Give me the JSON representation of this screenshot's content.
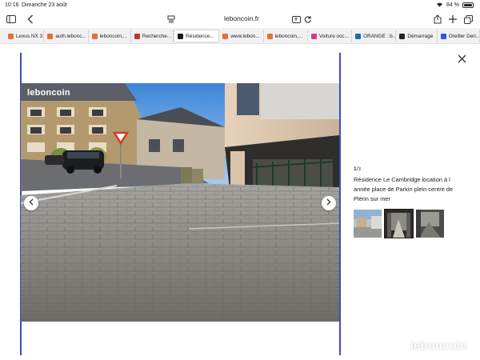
{
  "status_bar": {
    "time": "10:16",
    "date": "Dimanche 23 août",
    "battery": "84 %",
    "battery_level": 0.84
  },
  "toolbar": {
    "url": "leboncoin.fr"
  },
  "tabs": [
    {
      "label": "Lexus NX 3",
      "favicon_color": "#e5703b"
    },
    {
      "label": "auth.lebonc...",
      "favicon_color": "#e5703b"
    },
    {
      "label": "leboncoin,...",
      "favicon_color": "#e5703b"
    },
    {
      "label": "Recherche...",
      "favicon_color": "#c0392b"
    },
    {
      "label": "Résidence...",
      "favicon_color": "#1a1a1a",
      "active": true
    },
    {
      "label": "www.lebon...",
      "favicon_color": "#e5703b"
    },
    {
      "label": "leboncoin,...",
      "favicon_color": "#e5703b"
    },
    {
      "label": "Voiture occ...",
      "favicon_color": "#d63c8a"
    },
    {
      "label": "ORANGE : b...",
      "favicon_color": "#1c6ab5"
    },
    {
      "label": "Démarrage",
      "favicon_color": "#222222"
    },
    {
      "label": "Oreiller Deri...",
      "favicon_color": "#2a5bd7"
    }
  ],
  "listing": {
    "photo_logo": "leboncoin",
    "counter_current": "1",
    "counter_total": "/3",
    "title": "Résidence Le Cambridge location à l année place de Parkin plein centre de Plérin sur mer",
    "thumbnail_count": 3
  },
  "watermark": "leboncoin",
  "colors": {
    "frame_line": "#3b4fb8",
    "brand": "#ec5a13"
  }
}
